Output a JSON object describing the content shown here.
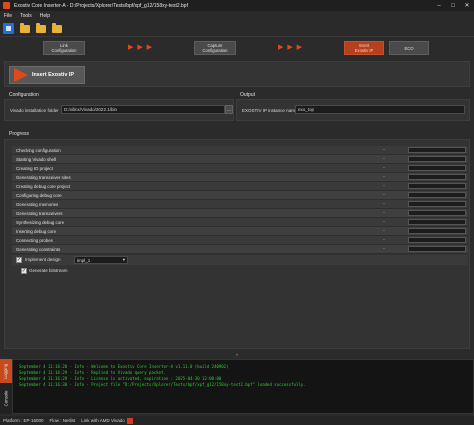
{
  "window": {
    "title": "Exostiv Core Inserter-A - D:/Projects/Xplorer/Tests/bpf/xpf_g12/158xy-test2.bpf",
    "controls": [
      "minimize",
      "maximize",
      "close"
    ]
  },
  "menu": [
    "File",
    "Tools",
    "Help"
  ],
  "toolbar": {
    "icons": [
      "app-home-icon",
      "folder-icon",
      "folder-icon",
      "folder-icon"
    ]
  },
  "workflow": {
    "steps": [
      {
        "label_line1": "Link",
        "label_line2": "Configuration",
        "active": false
      },
      {
        "label_line1": "Capture",
        "label_line2": "Configuration",
        "active": false
      },
      {
        "label_line1": "Insert",
        "label_line2": "Exostiv IP",
        "active": true
      },
      {
        "label_line1": "ECO",
        "label_line2": "",
        "active": false
      }
    ],
    "arrows": "▶ ▶ ▶"
  },
  "header": {
    "title": "Insert Exostiv IP"
  },
  "configuration": {
    "section_label": "Configuration",
    "vivado_label": "Vivado installation folder",
    "vivado_path": "D:/xilinx/Vivado/2022.1/bin",
    "browse_label": "..."
  },
  "output": {
    "section_label": "Output",
    "instance_label": "EXOSTIV IP instance name",
    "instance_value": "exo_top"
  },
  "progress": {
    "section_label": "Progress",
    "steps": [
      {
        "name": "Checking configuration",
        "status": "-"
      },
      {
        "name": "Starting Vivado shell",
        "status": "-"
      },
      {
        "name": "Creating IO project",
        "status": "-"
      },
      {
        "name": "Generating transceiver sites",
        "status": "-"
      },
      {
        "name": "Creating debug core project",
        "status": "-"
      },
      {
        "name": "Configuring debug core",
        "status": "-"
      },
      {
        "name": "Generating memories",
        "status": "-"
      },
      {
        "name": "Generating transceivers",
        "status": "-"
      },
      {
        "name": "Synthesizing debug core",
        "status": "-"
      },
      {
        "name": "Inserting debug core",
        "status": "-"
      },
      {
        "name": "Connecting probes",
        "status": "-"
      },
      {
        "name": "Generating constraints",
        "status": "-"
      }
    ],
    "implement_label": "Implement design",
    "implement_value": "impl_1",
    "bitstream_label": "Generate bitstream"
  },
  "console": {
    "tabs": [
      "Logging",
      "Console"
    ],
    "lines": [
      "September 4 11:16:28 - Info - Welcome to Exostiv Core Inserter-A v1.11.0 (build 240902)",
      "September 4 11:16:29 - Info - Replied to Vivado query packet.",
      "September 4 11:16:29 - Info - License is activated, expiration : 2025-04-30 12:00:00",
      "September 4 11:16:30 - Info - Project file \"D:/Projects/Xplorer/Tests/bpf/xpf_g12/158xy-test2.bpf\" loaded successfully."
    ]
  },
  "statusbar": {
    "platform": "Platform : EP-16000",
    "flow": "Flow : Netlist",
    "link": "Link with AMD Vivado"
  },
  "colors": {
    "accent": "#e04a1a",
    "log_text": "#35c93a",
    "background": "#2b2b2b"
  }
}
